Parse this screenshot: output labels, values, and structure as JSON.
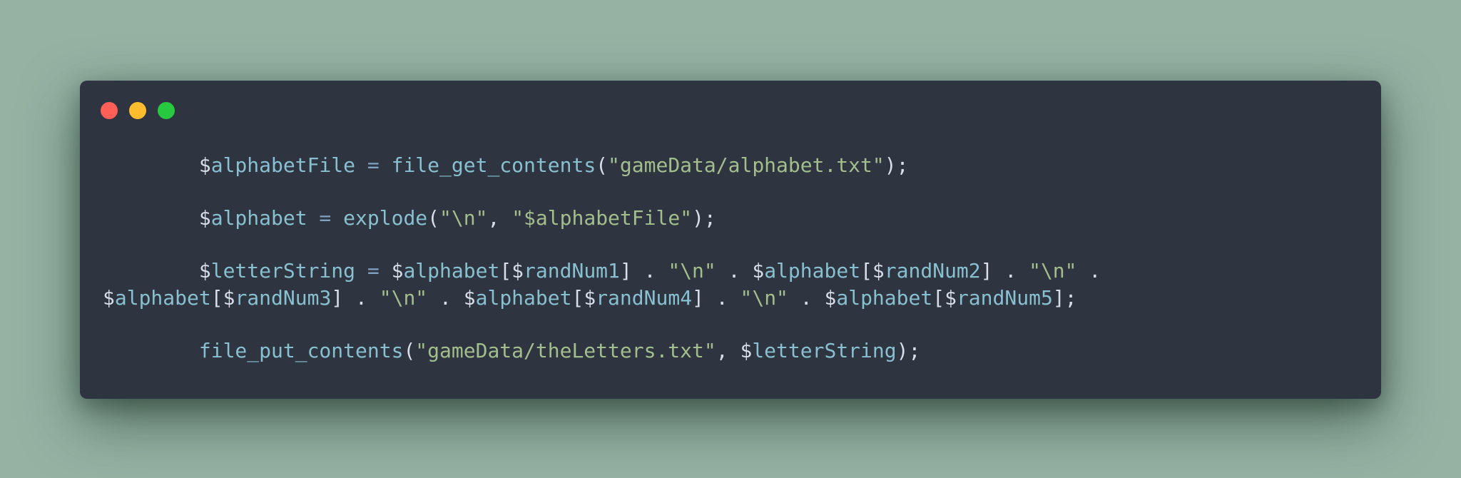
{
  "window": {
    "buttons": [
      {
        "name": "close",
        "color": "#ff5f56"
      },
      {
        "name": "minimize",
        "color": "#ffbd2e"
      },
      {
        "name": "maximize",
        "color": "#27c93f"
      }
    ]
  },
  "code": {
    "lines": [
      {
        "tokens": [
          {
            "t": "plain",
            "v": "        $"
          },
          {
            "t": "var",
            "v": "alphabetFile"
          },
          {
            "t": "op",
            "v": " = "
          },
          {
            "t": "fn",
            "v": "file_get_contents"
          },
          {
            "t": "punc",
            "v": "("
          },
          {
            "t": "str",
            "v": "\"gameData/alphabet.txt\""
          },
          {
            "t": "punc",
            "v": ");"
          }
        ]
      },
      {
        "blank": true
      },
      {
        "tokens": [
          {
            "t": "plain",
            "v": "        $"
          },
          {
            "t": "var",
            "v": "alphabet"
          },
          {
            "t": "op",
            "v": " = "
          },
          {
            "t": "fn",
            "v": "explode"
          },
          {
            "t": "punc",
            "v": "("
          },
          {
            "t": "str",
            "v": "\"\\n\""
          },
          {
            "t": "punc",
            "v": ", "
          },
          {
            "t": "str",
            "v": "\"$alphabetFile\""
          },
          {
            "t": "punc",
            "v": ");"
          }
        ]
      },
      {
        "blank": true
      },
      {
        "tokens": [
          {
            "t": "plain",
            "v": "        $"
          },
          {
            "t": "var",
            "v": "letterString"
          },
          {
            "t": "op",
            "v": " = "
          },
          {
            "t": "plain",
            "v": "$"
          },
          {
            "t": "var",
            "v": "alphabet"
          },
          {
            "t": "punc",
            "v": "["
          },
          {
            "t": "plain",
            "v": "$"
          },
          {
            "t": "var",
            "v": "randNum1"
          },
          {
            "t": "punc",
            "v": "] . "
          },
          {
            "t": "str",
            "v": "\"\\n\""
          },
          {
            "t": "punc",
            "v": " . "
          },
          {
            "t": "plain",
            "v": "$"
          },
          {
            "t": "var",
            "v": "alphabet"
          },
          {
            "t": "punc",
            "v": "["
          },
          {
            "t": "plain",
            "v": "$"
          },
          {
            "t": "var",
            "v": "randNum2"
          },
          {
            "t": "punc",
            "v": "] . "
          },
          {
            "t": "str",
            "v": "\"\\n\""
          },
          {
            "t": "punc",
            "v": " ."
          }
        ]
      },
      {
        "tokens": [
          {
            "t": "plain",
            "v": "$"
          },
          {
            "t": "var",
            "v": "alphabet"
          },
          {
            "t": "punc",
            "v": "["
          },
          {
            "t": "plain",
            "v": "$"
          },
          {
            "t": "var",
            "v": "randNum3"
          },
          {
            "t": "punc",
            "v": "] . "
          },
          {
            "t": "str",
            "v": "\"\\n\""
          },
          {
            "t": "punc",
            "v": " . "
          },
          {
            "t": "plain",
            "v": "$"
          },
          {
            "t": "var",
            "v": "alphabet"
          },
          {
            "t": "punc",
            "v": "["
          },
          {
            "t": "plain",
            "v": "$"
          },
          {
            "t": "var",
            "v": "randNum4"
          },
          {
            "t": "punc",
            "v": "] . "
          },
          {
            "t": "str",
            "v": "\"\\n\""
          },
          {
            "t": "punc",
            "v": " . "
          },
          {
            "t": "plain",
            "v": "$"
          },
          {
            "t": "var",
            "v": "alphabet"
          },
          {
            "t": "punc",
            "v": "["
          },
          {
            "t": "plain",
            "v": "$"
          },
          {
            "t": "var",
            "v": "randNum5"
          },
          {
            "t": "punc",
            "v": "];"
          }
        ]
      },
      {
        "blank": true
      },
      {
        "tokens": [
          {
            "t": "plain",
            "v": "        "
          },
          {
            "t": "fn",
            "v": "file_put_contents"
          },
          {
            "t": "punc",
            "v": "("
          },
          {
            "t": "str",
            "v": "\"gameData/theLetters.txt\""
          },
          {
            "t": "punc",
            "v": ", "
          },
          {
            "t": "plain",
            "v": "$"
          },
          {
            "t": "var",
            "v": "letterString"
          },
          {
            "t": "punc",
            "v": ");"
          }
        ]
      }
    ]
  }
}
